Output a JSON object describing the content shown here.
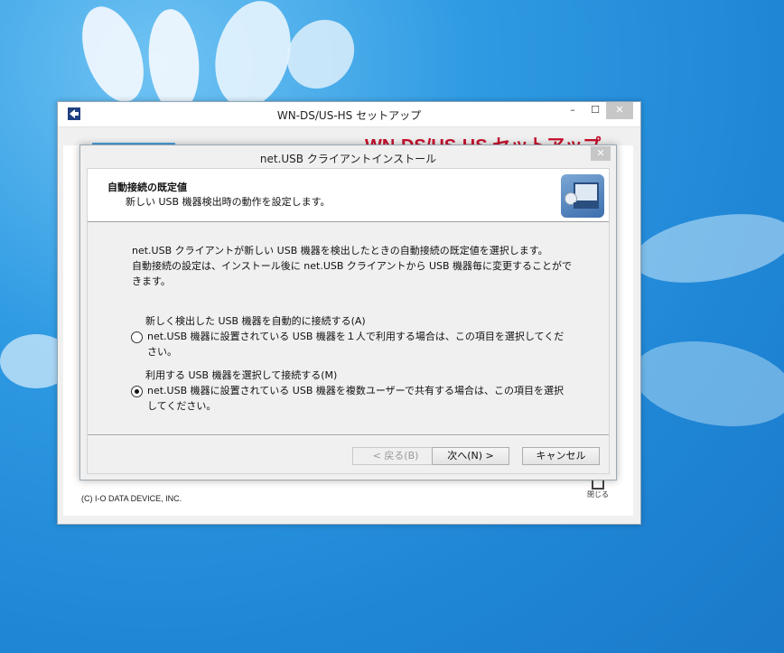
{
  "outer_window": {
    "title": "WN-DS/US-HS セットアップ",
    "brand": "WN-DS/US-HS セットアップ",
    "copyright": "(C) I-O DATA DEVICE, INC.",
    "close_label": "閉じる",
    "controls": {
      "minimize": "–",
      "maximize": "☐",
      "close": "✕"
    }
  },
  "dialog": {
    "title": "net.USB クライアントインストール",
    "close": "✕",
    "header_title": "自動接続の既定値",
    "header_subtitle": "新しい USB 機器検出時の動作を設定します。",
    "description_line1": "net.USB クライアントが新しい USB 機器を検出したときの自動接続の既定値を選択します。",
    "description_line2": "自動接続の設定は、インストール後に net.USB クライアントから USB 機器毎に変更することができます。",
    "options": [
      {
        "title": "新しく検出した USB 機器を自動的に接続する(A)",
        "detail": "net.USB 機器に設置されている USB 機器を１人で利用する場合は、この項目を選択してください。",
        "selected": false
      },
      {
        "title": "利用する USB 機器を選択して接続する(M)",
        "detail": "net.USB 機器に設置されている USB 機器を複数ユーザーで共有する場合は、この項目を選択してください。",
        "selected": true
      }
    ],
    "buttons": {
      "back": "< 戻る(B)",
      "next": "次へ(N) >",
      "cancel": "キャンセル"
    }
  }
}
